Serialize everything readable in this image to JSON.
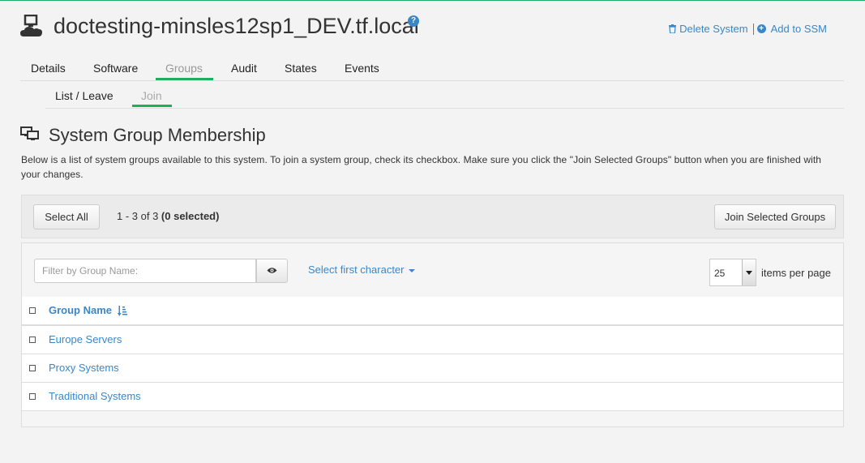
{
  "header": {
    "title": "doctesting-minsles12sp1_DEV.tf.local",
    "help_icon": "question-circle-icon",
    "system_icon": "system-cloud-icon",
    "actions": {
      "delete_label": "Delete System",
      "add_ssm_label": "Add to SSM"
    }
  },
  "tabs": [
    {
      "label": "Details",
      "active": false
    },
    {
      "label": "Software",
      "active": false
    },
    {
      "label": "Groups",
      "active": true
    },
    {
      "label": "Audit",
      "active": false
    },
    {
      "label": "States",
      "active": false
    },
    {
      "label": "Events",
      "active": false
    }
  ],
  "subtabs": [
    {
      "label": "List / Leave",
      "active": false
    },
    {
      "label": "Join",
      "active": true
    }
  ],
  "section": {
    "title": "System Group Membership",
    "icon": "desktop-group-icon",
    "description": "Below is a list of system groups available to this system. To join a system group, check its checkbox. Make sure you click the \"Join Selected Groups\" button when you are finished with your changes."
  },
  "toolbar": {
    "select_all_label": "Select All",
    "count_text": "1 - 3 of 3 ",
    "selected_text": "(0 selected)",
    "join_label": "Join Selected Groups"
  },
  "filter": {
    "placeholder": "Filter by Group Name:",
    "value": "",
    "first_char_label": "Select first character",
    "per_page_value": "25",
    "per_page_label": "items per page"
  },
  "table": {
    "header": "Group Name",
    "rows": [
      {
        "name": "Europe Servers",
        "checked": false
      },
      {
        "name": "Proxy Systems",
        "checked": false
      },
      {
        "name": "Traditional Systems",
        "checked": false
      }
    ]
  },
  "colors": {
    "accent_green": "#1fae5f",
    "link_blue": "#3a87c8"
  }
}
